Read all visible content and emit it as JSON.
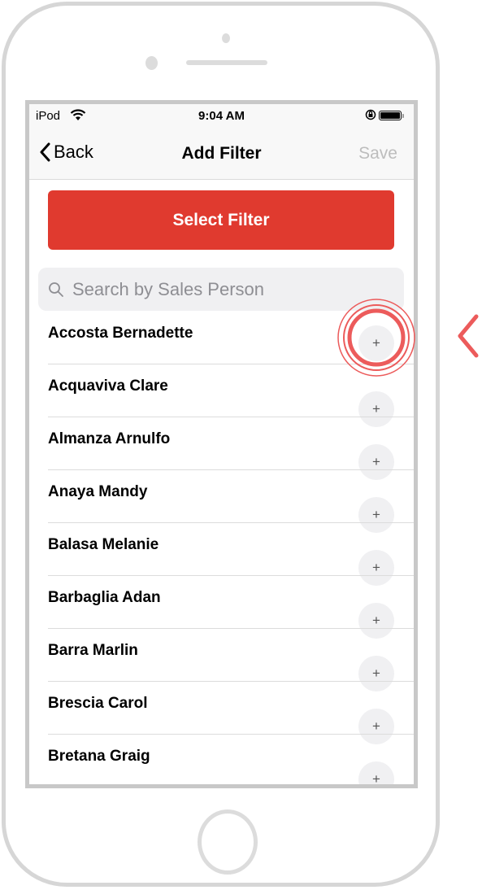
{
  "status_bar": {
    "carrier": "iPod",
    "time": "9:04 AM",
    "icons": [
      "wifi-icon",
      "rotation-lock-icon",
      "battery-icon"
    ]
  },
  "nav_bar": {
    "back_label": "Back",
    "title": "Add Filter",
    "save_label": "Save"
  },
  "select_filter": {
    "label": "Select Filter",
    "color": "#e03a2f"
  },
  "search": {
    "placeholder": "Search by Sales Person",
    "value": ""
  },
  "sales_people": [
    {
      "name": "Accosta Bernadette",
      "action": "+"
    },
    {
      "name": "Acquaviva Clare",
      "action": "+"
    },
    {
      "name": "Almanza Arnulfo",
      "action": "+"
    },
    {
      "name": "Anaya Mandy",
      "action": "+"
    },
    {
      "name": "Balasa Melanie",
      "action": "+"
    },
    {
      "name": "Barbaglia Adan",
      "action": "+"
    },
    {
      "name": "Barra Marlin",
      "action": "+"
    },
    {
      "name": "Brescia Carol",
      "action": "+"
    },
    {
      "name": "Bretana Graig",
      "action": "+"
    }
  ],
  "highlight": {
    "target": "Accosta Bernadette add button",
    "color": "#ec5b5b"
  }
}
